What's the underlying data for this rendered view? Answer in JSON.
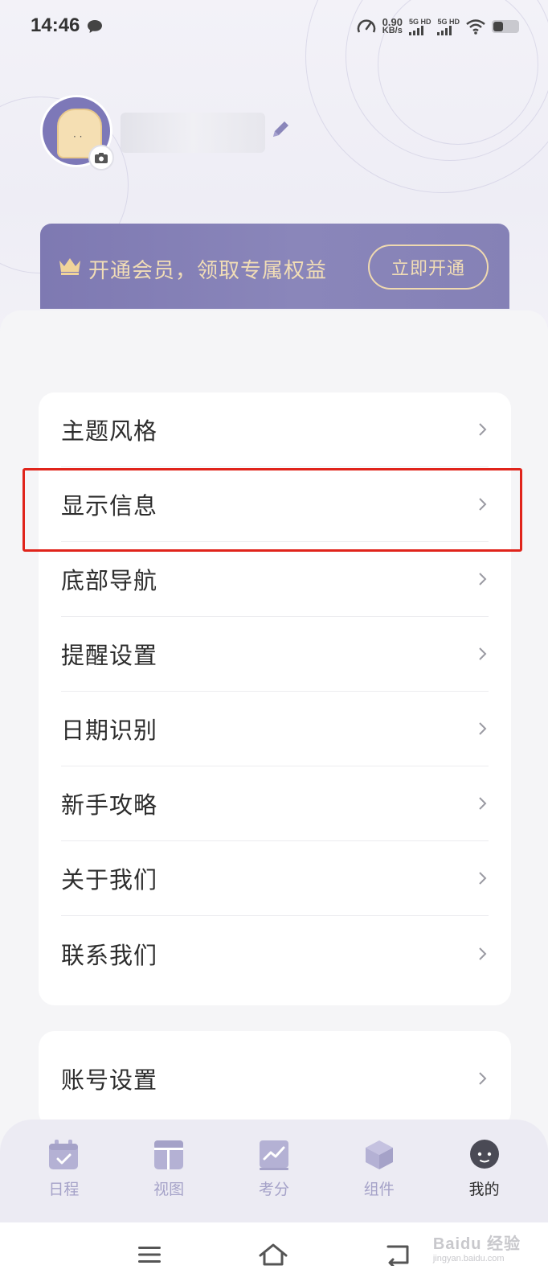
{
  "status_bar": {
    "time": "14:46",
    "net_speed_value": "0.90",
    "net_speed_unit": "KB/s",
    "sim1_label": "5G HD",
    "sim2_label": "5G HD"
  },
  "profile": {
    "username": "",
    "vip_text": "开通会员，领取专属权益",
    "vip_button": "立即开通"
  },
  "menu": {
    "items": [
      {
        "label": "主题风格"
      },
      {
        "label": "显示信息"
      },
      {
        "label": "底部导航"
      },
      {
        "label": "提醒设置"
      },
      {
        "label": "日期识别"
      },
      {
        "label": "新手攻略"
      },
      {
        "label": "关于我们"
      },
      {
        "label": "联系我们"
      }
    ],
    "account_label": "账号设置"
  },
  "bottom_nav": {
    "items": [
      {
        "label": "日程",
        "icon": "calendar-icon"
      },
      {
        "label": "视图",
        "icon": "layout-icon"
      },
      {
        "label": "考分",
        "icon": "chart-icon"
      },
      {
        "label": "组件",
        "icon": "cube-icon"
      },
      {
        "label": "我的",
        "icon": "profile-icon"
      }
    ],
    "active": "我的"
  },
  "colors": {
    "accent": "#8a86ba",
    "nav_inactive": "#a5a2c8",
    "vip_gold": "#f1ddb6",
    "highlight": "#e0241b"
  },
  "watermark": {
    "brand": "Baidu 经验",
    "domain": "jingyan.baidu.com"
  }
}
